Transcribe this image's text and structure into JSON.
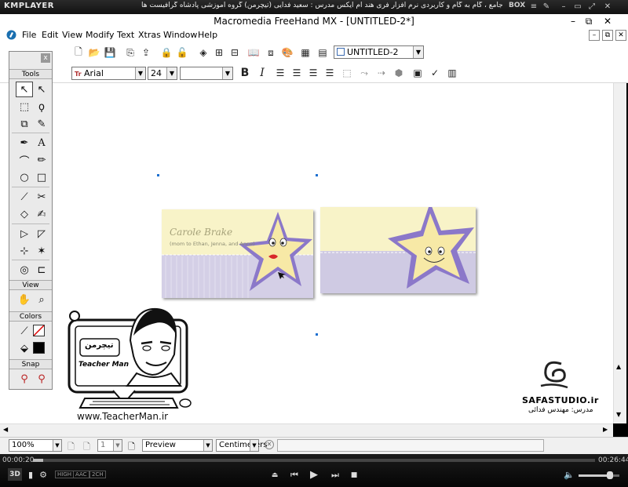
{
  "player": {
    "logo": "KMPLAYER",
    "title": "مجموعه آموزشی جامع ، گام به گام و کاربردی نرم افزار فری هند ام ایکس   مدرس : سعید فدایی (تیچرمن) گروه آموزشی پادشاه گرافیست ها",
    "box_label": "BOX",
    "time_elapsed": "00:00:20",
    "time_total": "00:26:44",
    "progress_fraction": 0.018,
    "volume_fraction": 0.7,
    "badges": [
      "3D",
      "HIGH",
      "AAC",
      "2CH"
    ]
  },
  "app": {
    "title": "Macromedia FreeHand MX - [UNTITLED-2*]",
    "menu": [
      "File",
      "Edit",
      "View",
      "Modify",
      "Text",
      "Xtras",
      "Window",
      "Help"
    ],
    "document_select": "UNTITLED-2",
    "font_name": "Arial",
    "font_size": "24",
    "bold_label": "B",
    "italic_label": "I",
    "text_tool_glyph": "Tr"
  },
  "tools_panel": {
    "close_label": "x",
    "sections": {
      "tools": "Tools",
      "view": "View",
      "colors": "Colors",
      "snap": "Snap"
    }
  },
  "status": {
    "zoom": "100%",
    "page": "1",
    "mode": "Preview",
    "units": "Centimeters"
  },
  "artwork": {
    "card_name": "Carole Brake",
    "card_subtitle": "(mom to Ethan, Jenna, and Anne)"
  },
  "watermarks": {
    "teacher_url": "www.TeacherMan.ir",
    "teacher_caption": "Teacher Man",
    "teacher_logo_text": "تیچرمن",
    "safa_name": "SAFASTUDIO.ir",
    "safa_teacher": "مدرس: مهندس فدائی"
  },
  "colors": {
    "app_bg": "#ffffff",
    "panel_bg": "#eaeaea",
    "star_fill": "#f7e9a6",
    "star_outline": "#8b78c9",
    "card_yellow": "#f8f3c8",
    "card_lilac": "#cfcae3",
    "player_bg": "#0c0c0c"
  }
}
